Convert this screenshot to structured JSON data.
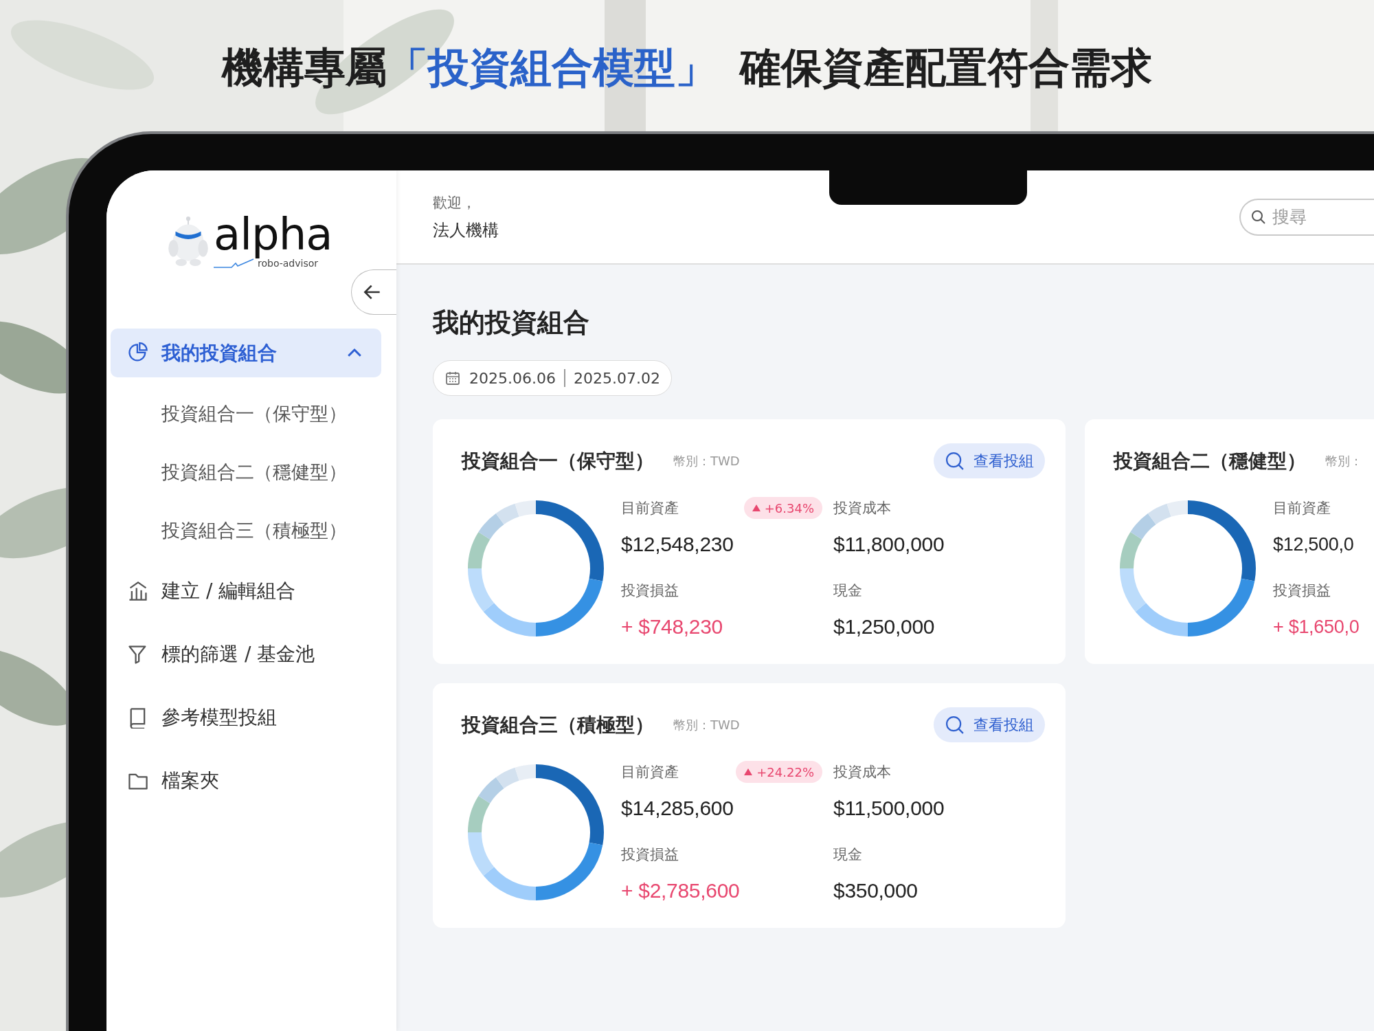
{
  "headline": {
    "parts": [
      {
        "text": "機構專屬",
        "highlight": false
      },
      {
        "text": "「投資組合模型」",
        "highlight": true
      },
      {
        "text": "確保資產配置符合需求",
        "highlight": false
      }
    ]
  },
  "logo": {
    "wordmark": "alpha",
    "tagline": "robo-advisor"
  },
  "sidebar": {
    "items": [
      {
        "kind": "group",
        "label": "我的投資組合",
        "selected": true,
        "expanded": true,
        "children": [
          {
            "label": "投資組合一（保守型）",
            "selected": false
          },
          {
            "label": "投資組合二（穩健型）",
            "selected": false
          },
          {
            "label": "投資組合三（積極型）",
            "selected": false
          }
        ]
      },
      {
        "kind": "link",
        "label": "建立 / 編輯組合",
        "selected": false
      },
      {
        "kind": "link",
        "label": "標的篩選 / 基金池",
        "selected": false
      },
      {
        "kind": "link",
        "label": "參考模型投組",
        "selected": false
      },
      {
        "kind": "link",
        "label": "檔案夾",
        "selected": false
      }
    ]
  },
  "header": {
    "greeting": "歡迎，",
    "user": "法人機構",
    "search": {
      "placeholder": "搜尋"
    }
  },
  "page": {
    "title": "我的投資組合",
    "date_range": {
      "start": "2025.06.06",
      "end": "2025.07.02"
    }
  },
  "portfolios": [
    {
      "name": "投資組合一（保守型）",
      "currency": "幣別：TWD",
      "button": "查看投組",
      "change": "+6.34%",
      "columns": [
        [
          {
            "label": "目前資產",
            "value": "$12,548,230",
            "kind": "normal"
          },
          {
            "label": "投資損益",
            "value": "+ $748,230",
            "kind": "gain"
          }
        ],
        [
          {
            "label": "投資成本",
            "value": "$11,800,000",
            "kind": "normal"
          },
          {
            "label": "現金",
            "value": "$1,250,000",
            "kind": "normal"
          }
        ]
      ]
    },
    {
      "name": "投資組合二（穩健型）",
      "currency": "幣別：",
      "columns": [
        [
          {
            "label": "目前資產",
            "value": "$12,500,0",
            "kind": "normal"
          },
          {
            "label": "投資損益",
            "value": "+ $1,650,0",
            "kind": "gain"
          }
        ]
      ]
    },
    {
      "name": "投資組合三（積極型）",
      "currency": "幣別：TWD",
      "button": "查看投組",
      "change": "+24.22%",
      "columns": [
        [
          {
            "label": "目前資產",
            "value": "$14,285,600",
            "kind": "normal"
          },
          {
            "label": "投資損益",
            "value": "+ $2,785,600",
            "kind": "gain"
          }
        ],
        [
          {
            "label": "投資成本",
            "value": "$11,500,000",
            "kind": "normal"
          },
          {
            "label": "現金",
            "value": "$350,000",
            "kind": "normal"
          }
        ]
      ]
    }
  ]
}
